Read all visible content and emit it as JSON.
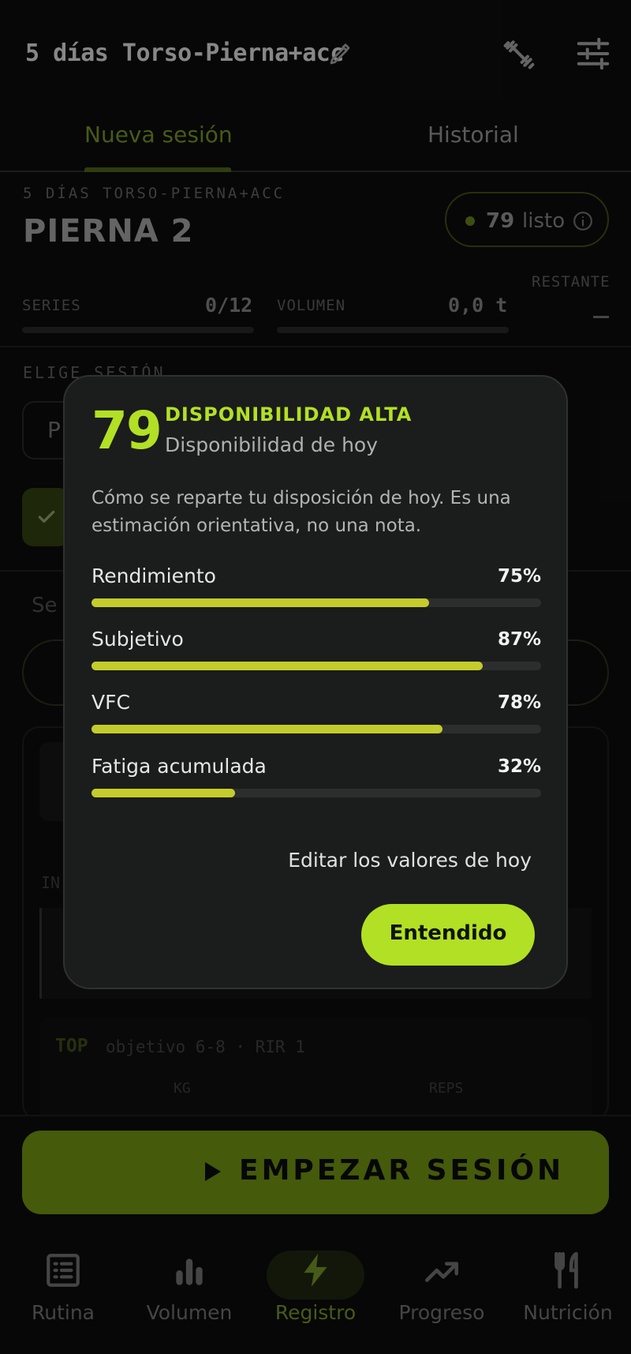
{
  "header": {
    "title": "5 días Torso-Pierna+acc"
  },
  "tabs": [
    {
      "label": "Nueva sesión"
    },
    {
      "label": "Historial"
    }
  ],
  "session": {
    "routine_label": "5 DÍAS TORSO-PIERNA+ACC",
    "name": "PIERNA 2",
    "ready_score": "79",
    "ready_text": "listo"
  },
  "stats": {
    "series_label": "SERIES",
    "series_value": "0/12",
    "volume_label": "VOLUMEN",
    "volume_value": "0,0 t",
    "remaining_label": "RESTANTE"
  },
  "background": {
    "choose_label": "ELIGE SESIÓN",
    "box_letter": "P",
    "se_text": "Se",
    "int_text": "IN",
    "top_label": "TOP",
    "top_objective": "objetivo 6-8 · RIR 1",
    "kg_label": "KG",
    "reps_label": "REPS"
  },
  "start_button": {
    "label": "EMPEZAR SESIÓN"
  },
  "nav": [
    {
      "label": "Rutina",
      "icon": "list-icon"
    },
    {
      "label": "Volumen",
      "icon": "bar-chart-icon"
    },
    {
      "label": "Registro",
      "icon": "bolt-icon"
    },
    {
      "label": "Progreso",
      "icon": "trend-icon"
    },
    {
      "label": "Nutrición",
      "icon": "utensils-icon"
    }
  ],
  "modal": {
    "score": "79",
    "level_title": "DISPONIBILIDAD ALTA",
    "level_subtitle": "Disponibilidad de hoy",
    "description": "Cómo se reparte tu disposición de hoy. Es una estimación orientativa, no una nota.",
    "metrics": [
      {
        "name": "Rendimiento",
        "percent_text": "75%",
        "value": 75
      },
      {
        "name": "Subjetivo",
        "percent_text": "87%",
        "value": 87
      },
      {
        "name": "VFC",
        "percent_text": "78%",
        "value": 78
      },
      {
        "name": "Fatiga acumulada",
        "percent_text": "32%",
        "value": 32
      }
    ],
    "edit_link": "Editar los valores de hoy",
    "ok_button": "Entendido"
  },
  "colors": {
    "accent": "#b2e024",
    "bar_fill": "#c4cc2c",
    "start_button": "#6a8a12"
  }
}
